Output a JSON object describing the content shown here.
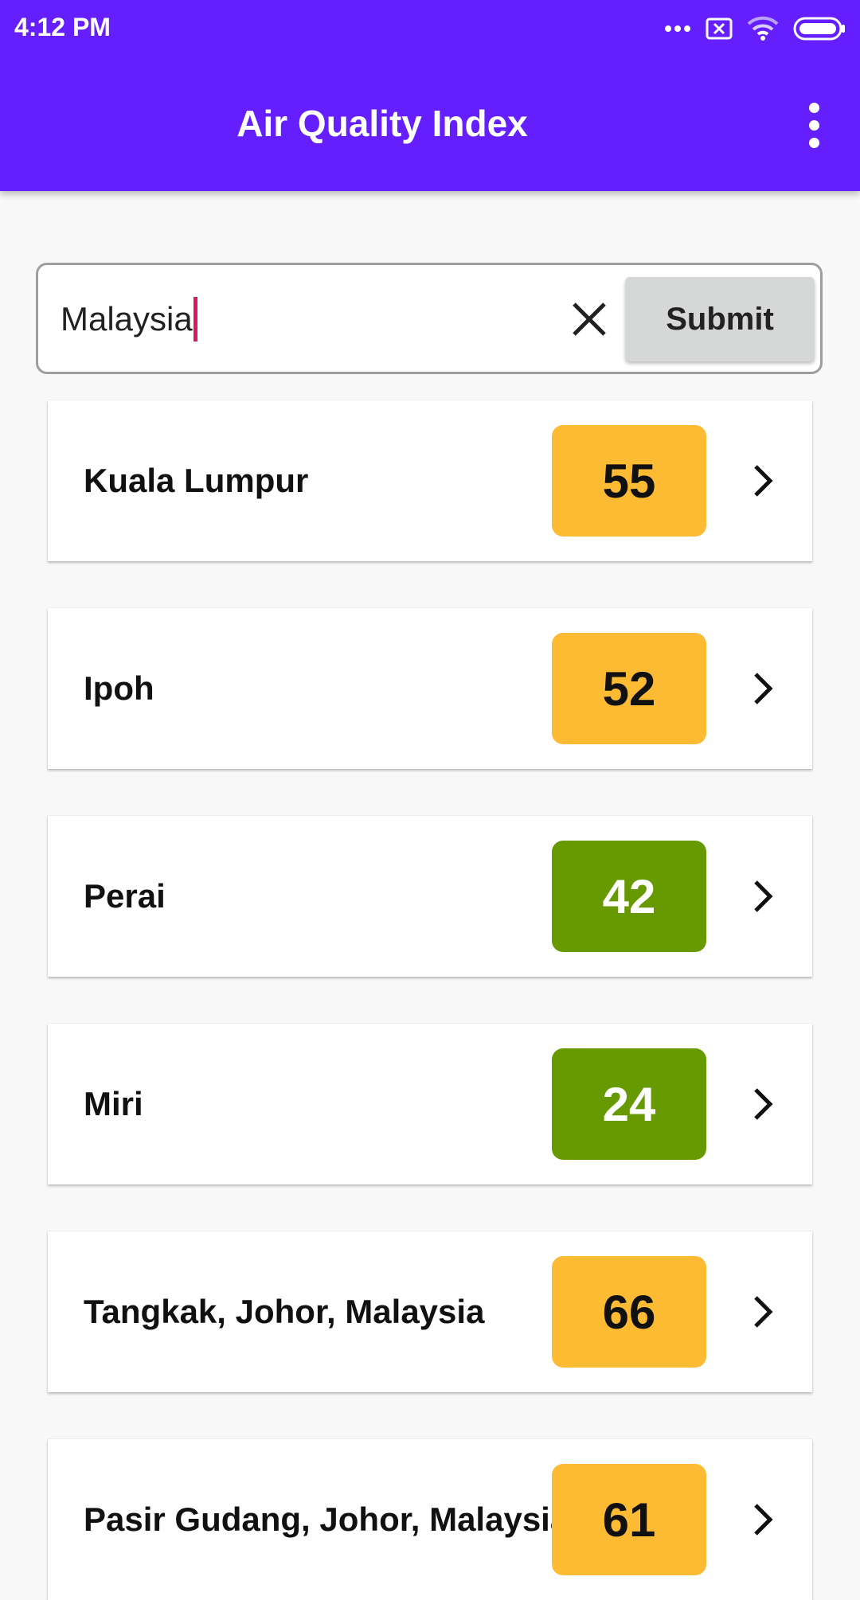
{
  "status_bar": {
    "time": "4:12 PM",
    "icons": [
      "more-dots-icon",
      "notification-icon",
      "wifi-icon",
      "battery-icon"
    ]
  },
  "app_bar": {
    "title": "Air Quality Index",
    "menu_icon": "overflow-menu-icon"
  },
  "search": {
    "value": "Malaysia",
    "clear_icon": "close-icon",
    "submit_label": "Submit"
  },
  "colors": {
    "app_bar": "#651fff",
    "moderate": "#fdbb34",
    "good": "#669a00",
    "caret": "#d81b60"
  },
  "cities": [
    {
      "name": "Kuala Lumpur",
      "aqi": "55",
      "level": "moderate"
    },
    {
      "name": "Ipoh",
      "aqi": "52",
      "level": "moderate"
    },
    {
      "name": "Perai",
      "aqi": "42",
      "level": "good"
    },
    {
      "name": "Miri",
      "aqi": "24",
      "level": "good"
    },
    {
      "name": "Tangkak, Johor, Malaysia",
      "aqi": "66",
      "level": "moderate"
    },
    {
      "name": "Pasir Gudang, Johor, Malaysia",
      "aqi": "61",
      "level": "moderate"
    }
  ]
}
